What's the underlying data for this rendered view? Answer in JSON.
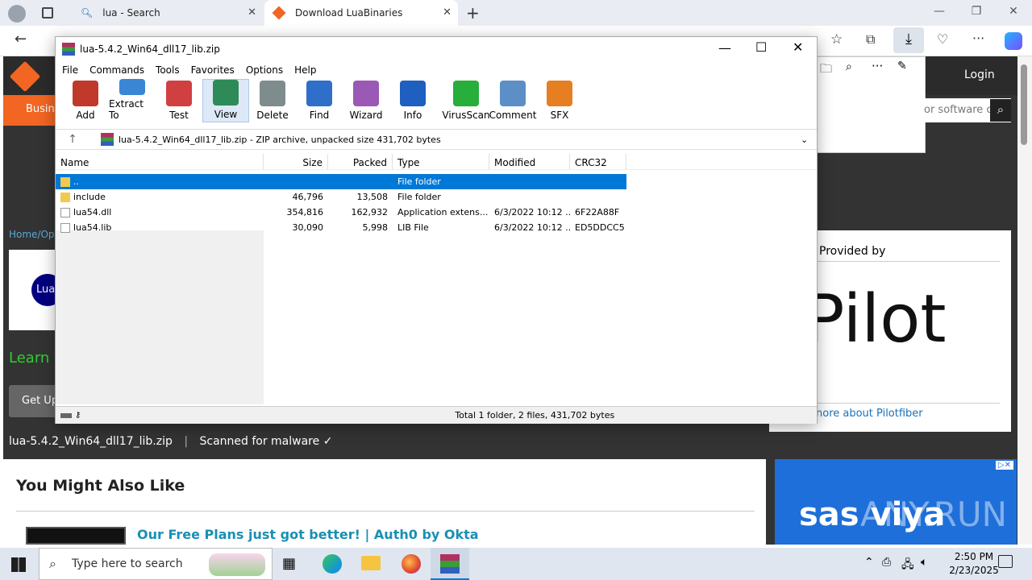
{
  "browser": {
    "tabs": [
      {
        "label": "lua - Search"
      },
      {
        "label": "Download LuaBinaries"
      }
    ]
  },
  "site": {
    "login": "Login",
    "nav_partial": "Busin",
    "search_placeholder": "or software c",
    "breadcrumb": "Home/Op",
    "logo_text": "Lua",
    "learn_partial": "Learn r",
    "cta_partial": "Get Up",
    "ad_provided_by": "Provided by",
    "ad_brand_partial": "Pilot",
    "ad_link_partial": "nore about Pilotfiber",
    "file_name": "lua-5.4.2_Win64_dll17_lib.zip",
    "scanned": "Scanned for malware ✓",
    "also_like": "You Might Also Like",
    "related_title": "Our Free Plans just got better! | Auth0 by Okta",
    "sas_ad": "sas viya",
    "watermark": "ANY.RUN"
  },
  "rar": {
    "title": "lua-5.4.2_Win64_dll17_lib.zip",
    "menu": [
      "File",
      "Commands",
      "Tools",
      "Favorites",
      "Options",
      "Help"
    ],
    "toolbar": [
      {
        "label": "Add",
        "color": "#c0392b"
      },
      {
        "label": "Extract To",
        "color": "#3a86d4"
      },
      {
        "label": "Test",
        "color": "#d04040"
      },
      {
        "label": "View",
        "color": "#2e8b57"
      },
      {
        "label": "Delete",
        "color": "#7f8c8d"
      },
      {
        "label": "Find",
        "color": "#2f6fc9"
      },
      {
        "label": "Wizard",
        "color": "#9b59b6"
      },
      {
        "label": "Info",
        "color": "#1f5fbf"
      },
      {
        "label": "VirusScan",
        "color": "#27ae3b"
      },
      {
        "label": "Comment",
        "color": "#5d8fc7"
      },
      {
        "label": "SFX",
        "color": "#e67e22"
      }
    ],
    "path": "lua-5.4.2_Win64_dll17_lib.zip - ZIP archive, unpacked size 431,702 bytes",
    "columns": [
      "Name",
      "Size",
      "Packed",
      "Type",
      "Modified",
      "CRC32"
    ],
    "rows": [
      {
        "name": "..",
        "size": "",
        "packed": "",
        "type": "File folder",
        "modified": "",
        "crc": ""
      },
      {
        "name": "include",
        "size": "46,796",
        "packed": "13,508",
        "type": "File folder",
        "modified": "",
        "crc": ""
      },
      {
        "name": "lua54.dll",
        "size": "354,816",
        "packed": "162,932",
        "type": "Application extens...",
        "modified": "6/3/2022 10:12 ...",
        "crc": "6F22A88F"
      },
      {
        "name": "lua54.lib",
        "size": "30,090",
        "packed": "5,998",
        "type": "LIB File",
        "modified": "6/3/2022 10:12 ...",
        "crc": "ED5DDCC5"
      }
    ],
    "status": "Total 1 folder, 2 files, 431,702 bytes"
  },
  "taskbar": {
    "search_placeholder": "Type here to search",
    "time": "2:50 PM",
    "date": "2/23/2025"
  }
}
